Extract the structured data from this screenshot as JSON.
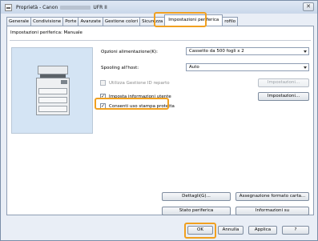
{
  "window": {
    "title_prefix": "Proprietà - Canon",
    "title_suffix": "UFR II",
    "close_glyph": "✕"
  },
  "tabs": [
    {
      "label": "Generale"
    },
    {
      "label": "Condivisione"
    },
    {
      "label": "Porte"
    },
    {
      "label": "Avanzate"
    },
    {
      "label": "Gestione colori"
    },
    {
      "label": "Sicurezza"
    },
    {
      "label": "Impostazioni periferica",
      "active": true
    },
    {
      "label": "rofilo"
    }
  ],
  "panel": {
    "title": "Impostazioni periferica: Manuale"
  },
  "options": {
    "paper_source_label": "Opzioni alimentazione(K):",
    "paper_source_value": "Cassetto da 500 fogli x 2",
    "spooling_label": "Spooling all'host:",
    "spooling_value": "Auto"
  },
  "checkboxes": {
    "dept_id": {
      "label": "Utilizza Gestione ID reparto",
      "checked": false,
      "enabled": false
    },
    "user_info": {
      "label": "Imposta informazioni utente",
      "checked": true,
      "enabled": true
    },
    "secure_print": {
      "label": "Consenti uso stampa protetta",
      "checked": true,
      "enabled": true
    },
    "check_glyph": "✓"
  },
  "buttons": {
    "dept_settings": "Impostazioni...",
    "user_settings": "Impostazioni...",
    "details": "Dettagli(G)...",
    "paper_format": "Assegnazione formato carta...",
    "device_status": "Stato periferica",
    "about": "Informazioni su",
    "ok": "OK",
    "cancel": "Annulla",
    "apply": "Applica",
    "help": "?"
  },
  "colors": {
    "highlight": "#f0a020",
    "preview_bg": "#d4e4f4"
  }
}
